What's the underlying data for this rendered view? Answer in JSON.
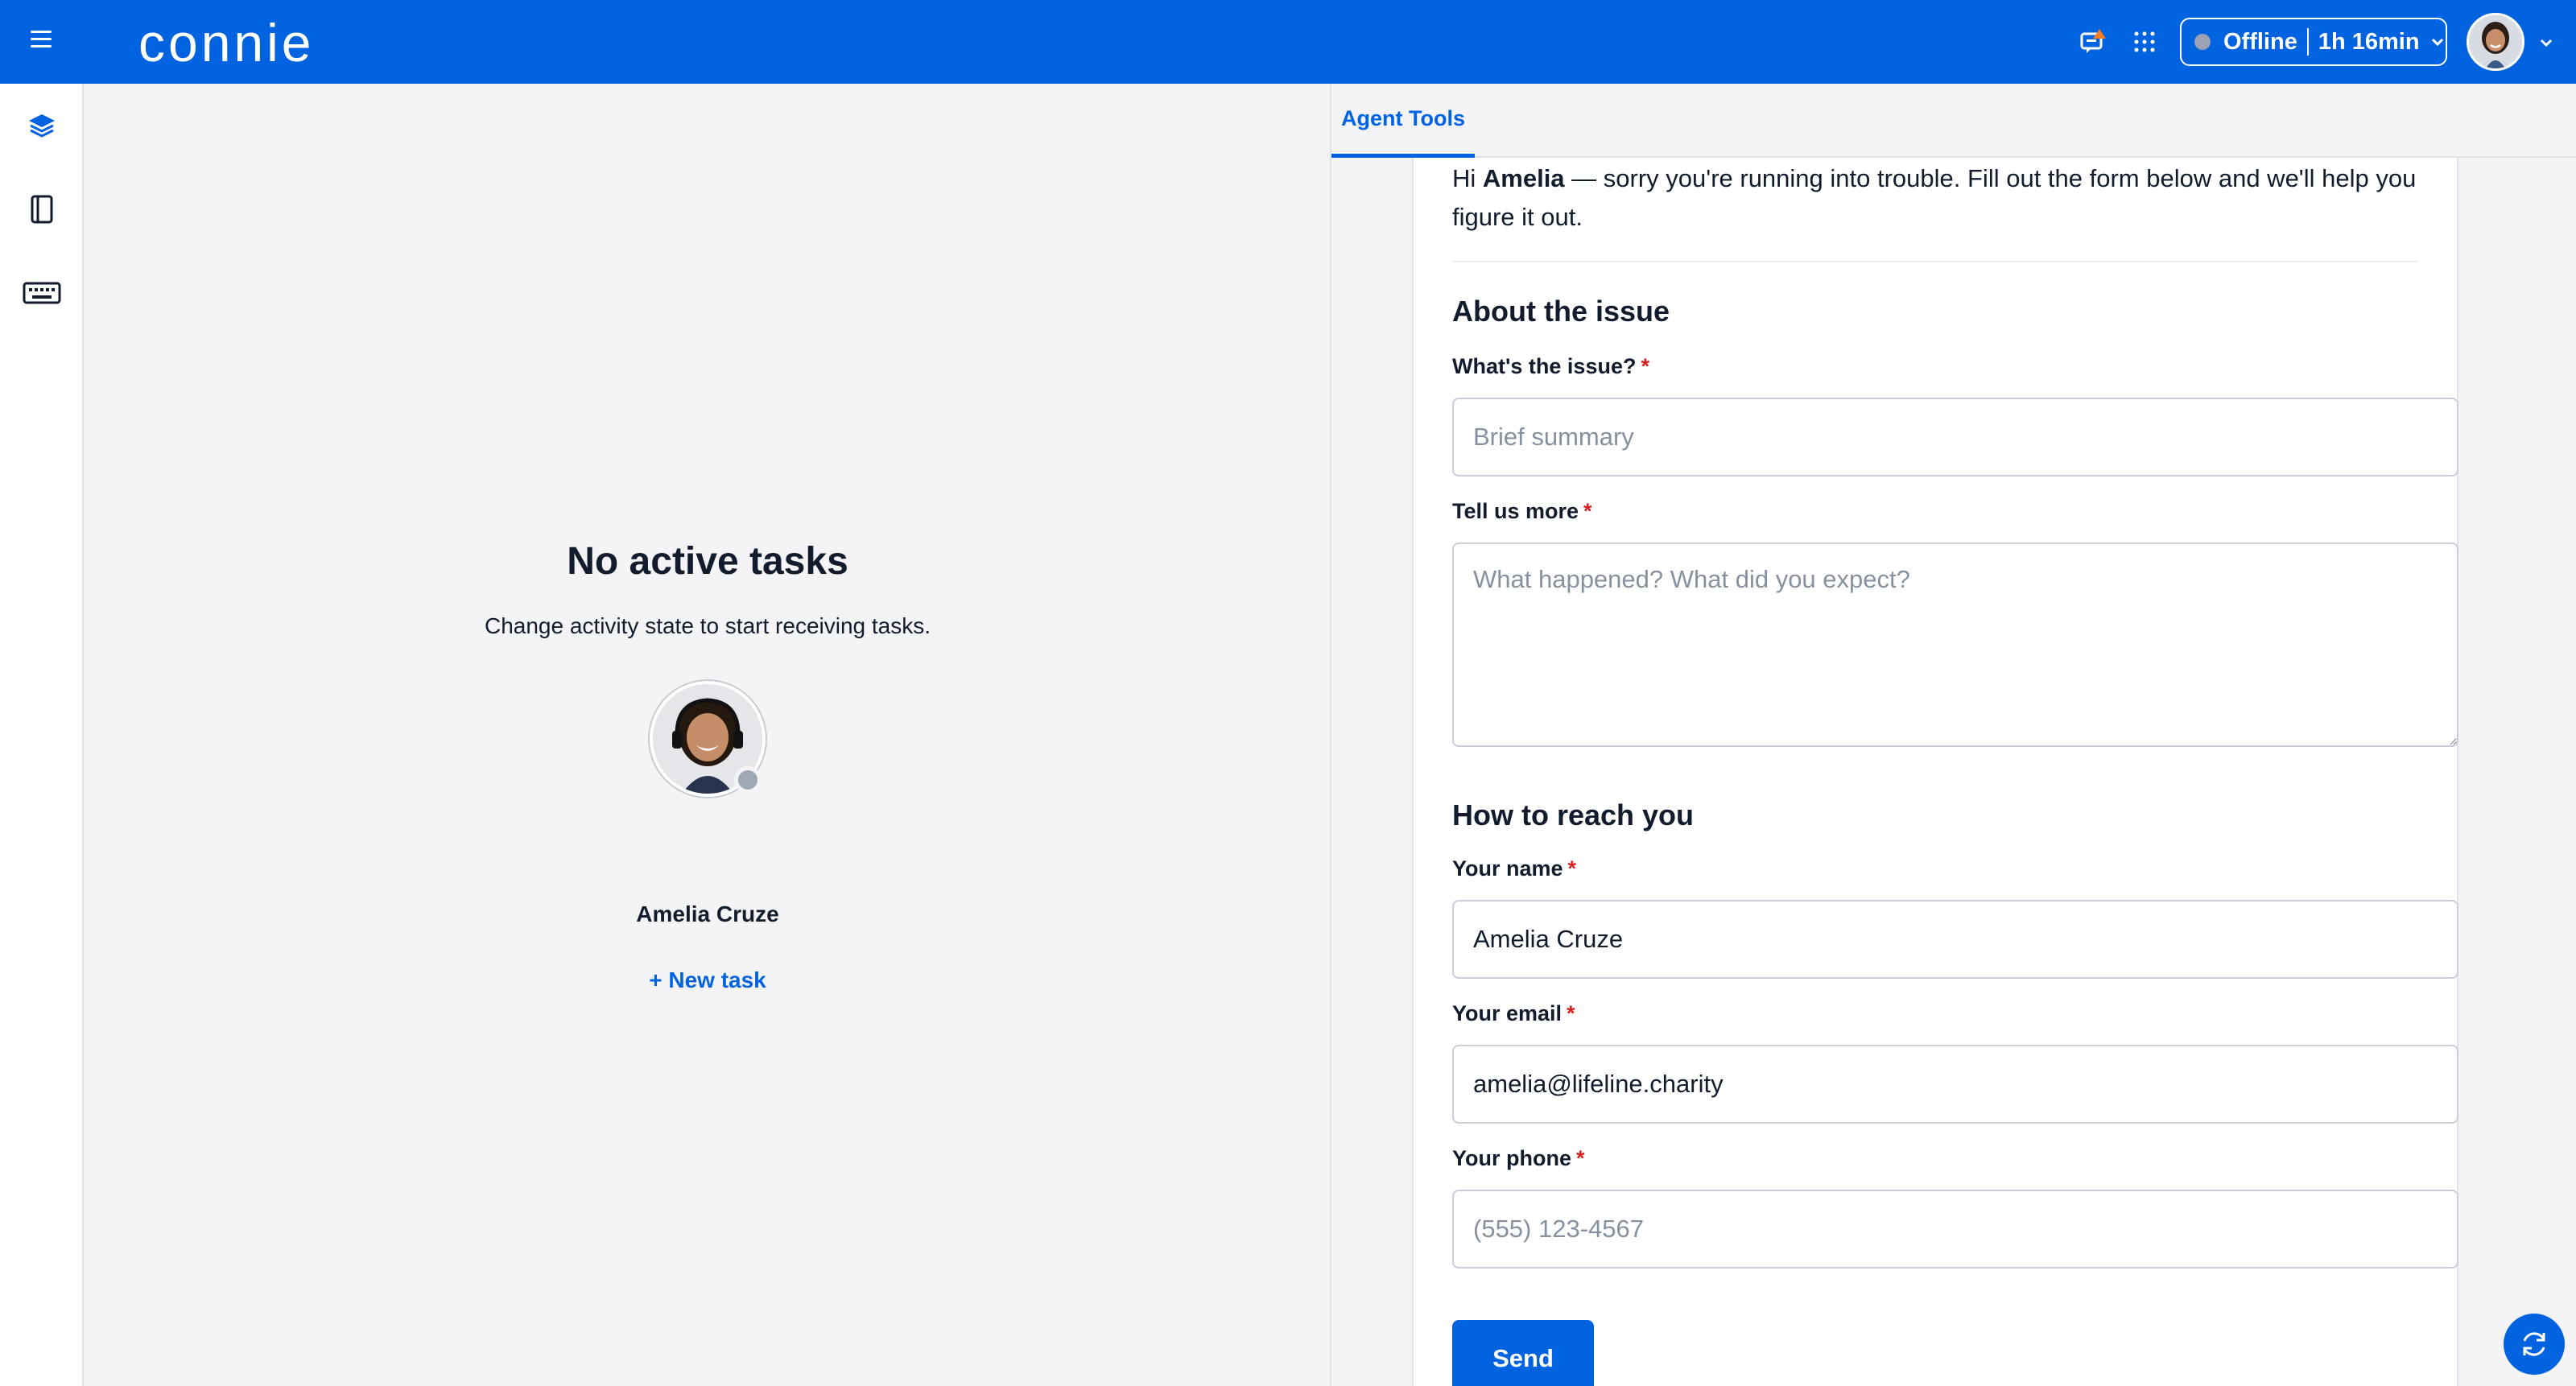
{
  "header": {
    "logo_text": "connie",
    "status": {
      "state": "Offline",
      "duration": "1h 16min",
      "dot_color": "#9aa2b3"
    },
    "brand_color": "#0263e0",
    "notification_color": "#f47c22"
  },
  "nav": {
    "items": [
      {
        "icon": "layers-icon"
      },
      {
        "icon": "directory-icon"
      },
      {
        "icon": "keyboard-icon"
      }
    ]
  },
  "main": {
    "title": "No active tasks",
    "subtitle": "Change activity state to start receiving tasks.",
    "agent_name": "Amelia Cruze",
    "new_task_label": "+ New task"
  },
  "panel": {
    "tab_label": "Agent Tools",
    "intro": {
      "greeting": "Hi ",
      "name": "Amelia",
      "rest": " — sorry you're running into trouble. Fill out the form below and we'll help you figure it out."
    },
    "section_issue": "About the issue",
    "issue_label": "What's the issue?",
    "issue_placeholder": "Brief summary",
    "more_label": "Tell us more",
    "more_placeholder": "What happened? What did you expect?",
    "section_contact": "How to reach you",
    "name_label": "Your name",
    "name_value": "Amelia Cruze",
    "email_label": "Your email",
    "email_value": "amelia@lifeline.charity",
    "phone_label": "Your phone",
    "phone_placeholder": "(555) 123-4567",
    "required_mark": "*",
    "send_label": "Send"
  }
}
